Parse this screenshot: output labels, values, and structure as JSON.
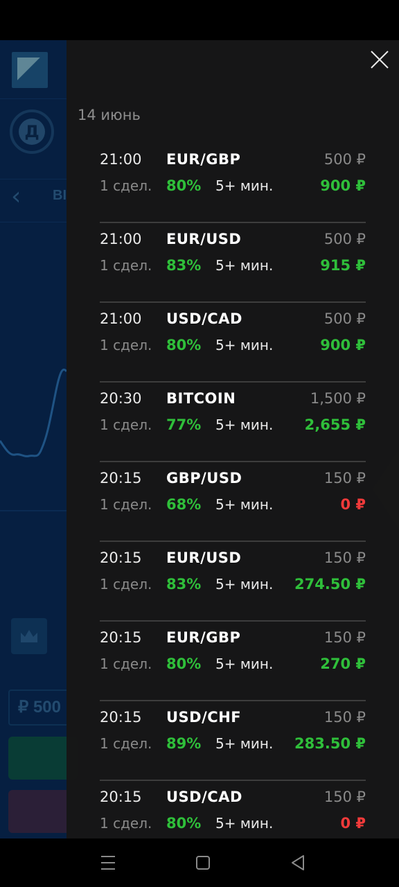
{
  "colors": {
    "panel_bg": "#161616",
    "background_app": "#082a57",
    "win": "#2fbf3a",
    "loss": "#f03a3a",
    "muted": "#8a8a8a",
    "divider": "#3d3d3d"
  },
  "background_app": {
    "avatar_letter": "Д",
    "back_label": "ВІ",
    "amount_text": "₽ 500"
  },
  "panel": {
    "close_icon": "close-icon",
    "date_header": "14 июнь"
  },
  "trades": [
    {
      "time": "21:00",
      "asset": "EUR/GBP",
      "stake": "500 ₽",
      "count": "1 сдел.",
      "percent": "80%",
      "duration": "5+ мин.",
      "payout": "900 ₽",
      "result": "win"
    },
    {
      "time": "21:00",
      "asset": "EUR/USD",
      "stake": "500 ₽",
      "count": "1 сдел.",
      "percent": "83%",
      "duration": "5+ мин.",
      "payout": "915 ₽",
      "result": "win"
    },
    {
      "time": "21:00",
      "asset": "USD/CAD",
      "stake": "500 ₽",
      "count": "1 сдел.",
      "percent": "80%",
      "duration": "5+ мин.",
      "payout": "900 ₽",
      "result": "win"
    },
    {
      "time": "20:30",
      "asset": "BITCOIN",
      "stake": "1,500 ₽",
      "count": "1 сдел.",
      "percent": "77%",
      "duration": "5+ мин.",
      "payout": "2,655 ₽",
      "result": "win"
    },
    {
      "time": "20:15",
      "asset": "GBP/USD",
      "stake": "150 ₽",
      "count": "1 сдел.",
      "percent": "68%",
      "duration": "5+ мин.",
      "payout": "0 ₽",
      "result": "loss"
    },
    {
      "time": "20:15",
      "asset": "EUR/USD",
      "stake": "150 ₽",
      "count": "1 сдел.",
      "percent": "83%",
      "duration": "5+ мин.",
      "payout": "274.50 ₽",
      "result": "win"
    },
    {
      "time": "20:15",
      "asset": "EUR/GBP",
      "stake": "150 ₽",
      "count": "1 сдел.",
      "percent": "80%",
      "duration": "5+ мин.",
      "payout": "270 ₽",
      "result": "win"
    },
    {
      "time": "20:15",
      "asset": "USD/CHF",
      "stake": "150 ₽",
      "count": "1 сдел.",
      "percent": "89%",
      "duration": "5+ мин.",
      "payout": "283.50 ₽",
      "result": "win"
    },
    {
      "time": "20:15",
      "asset": "USD/CAD",
      "stake": "150 ₽",
      "count": "1 сдел.",
      "percent": "80%",
      "duration": "5+ мин.",
      "payout": "0 ₽",
      "result": "loss"
    }
  ],
  "nav_bar": {
    "menu_icon": "menu-icon",
    "home_icon": "home-icon",
    "back_icon": "back-icon"
  }
}
